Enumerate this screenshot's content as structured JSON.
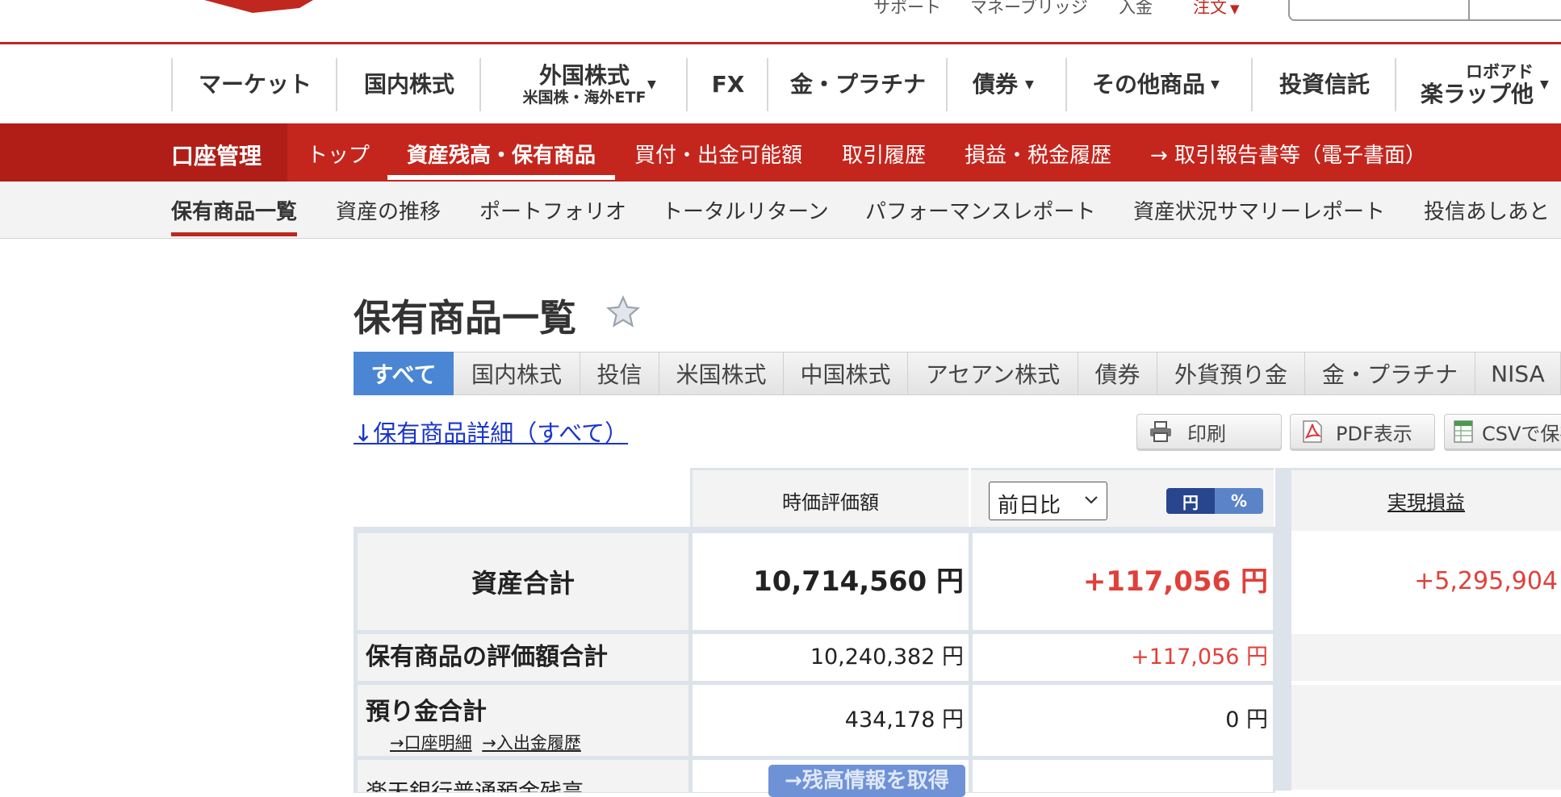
{
  "header": {
    "utility_links": [
      "サポート",
      "マネーブリッジ",
      "入金"
    ],
    "order_label": "注文",
    "caret": "▼"
  },
  "main_nav": {
    "items": [
      {
        "label": "マーケット"
      },
      {
        "label": "国内株式"
      },
      {
        "label": "外国株式",
        "sub": "米国株・海外ETF",
        "caret": "▼"
      },
      {
        "label": "FX"
      },
      {
        "label": "金・プラチナ"
      },
      {
        "label": "債券",
        "caret": "▼"
      },
      {
        "label": "その他商品",
        "caret": "▼"
      },
      {
        "label": "投資信託"
      },
      {
        "label": "楽ラップ他",
        "sub_top": "ロボアド",
        "caret": "▼"
      }
    ]
  },
  "account_nav": {
    "title": "口座管理",
    "items": [
      "トップ",
      "資産残高・保有商品",
      "買付・出金可能額",
      "取引履歴",
      "損益・税金履歴",
      "→ 取引報告書等（電子書面）"
    ],
    "active_index": 1
  },
  "sub_nav": {
    "items": [
      "保有商品一覧",
      "資産の推移",
      "ポートフォリオ",
      "トータルリターン",
      "パフォーマンスレポート",
      "資産状況サマリーレポート",
      "投信あしあと"
    ],
    "active_index": 0
  },
  "page": {
    "title": "保有商品一覧",
    "favorite_icon": "star-icon",
    "category_tabs": [
      "すべて",
      "国内株式",
      "投信",
      "米国株式",
      "中国株式",
      "アセアン株式",
      "債券",
      "外貨預り金",
      "金・プラチナ",
      "NISA"
    ],
    "active_tab_index": 0,
    "detail_link": "↓保有商品詳細（すべて）",
    "tool_buttons": [
      "印刷",
      "PDF表示",
      "CSVで保存"
    ]
  },
  "summary_table": {
    "col_market_value": "時価評価額",
    "col_change_select": "前日比",
    "unit_toggle": [
      "円",
      "%"
    ],
    "unit_active": "円",
    "col_realized": "実現損益",
    "rows": {
      "total": {
        "label": "資産合計",
        "value": "10,714,560 円",
        "change": "+117,056 円",
        "realized": "+5,295,904"
      },
      "holdings": {
        "label": "保有商品の評価額合計",
        "value": "10,240,382 円",
        "change": "+117,056 円"
      },
      "deposit": {
        "label": "預り金合計",
        "value": "434,178 円",
        "change": "0 円",
        "links": [
          "→口座明細",
          "→入出金履歴"
        ]
      },
      "bank": {
        "label": "楽天銀行普通預金残高",
        "button": "→残高情報を取得"
      }
    }
  },
  "colors": {
    "brand_red": "#c4261d",
    "tab_active_blue": "#4a86d3",
    "positive_red": "#e0403a",
    "link_blue": "#1a36c8"
  }
}
